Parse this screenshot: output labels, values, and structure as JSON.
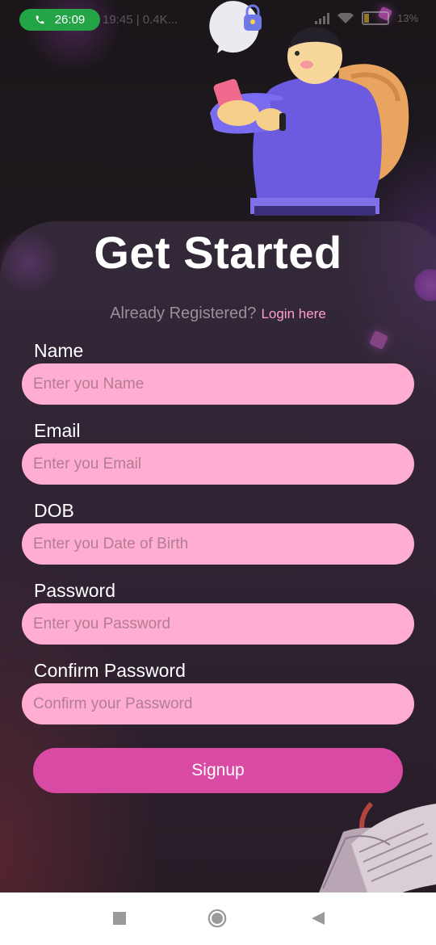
{
  "status_bar": {
    "call_timer": "26:09",
    "left_text": "19:45 | 0.4K...",
    "battery_percent": "13"
  },
  "page": {
    "title": "Get Started",
    "already_registered": "Already Registered?",
    "login_link": "Login here"
  },
  "form": {
    "fields": [
      {
        "label": "Name",
        "placeholder": "Enter you Name"
      },
      {
        "label": "Email",
        "placeholder": "Enter you Email"
      },
      {
        "label": "DOB",
        "placeholder": "Enter you Date of Birth"
      },
      {
        "label": "Password",
        "placeholder": "Enter you Password"
      },
      {
        "label": "Confirm Password",
        "placeholder": "Confirm your Password"
      }
    ],
    "submit_label": "Signup"
  },
  "icons": {
    "hero": "person-with-phone-and-backpack-illustration",
    "lock": "lock-icon",
    "book": "open-book-illustration",
    "nav": [
      "square-recents-icon",
      "circle-home-icon",
      "triangle-back-icon"
    ]
  },
  "colors": {
    "field_bg": "#ffadd1",
    "button_bg": "#d94aa4",
    "link": "#ff9fd0",
    "call_pill": "#22a447"
  }
}
